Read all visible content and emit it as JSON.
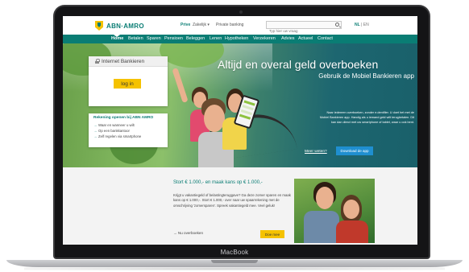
{
  "device": {
    "label": "MacBook"
  },
  "topbar": {
    "logo_text": "ABN·AMRO",
    "segments": [
      "Prive",
      "Zakelijk ▾",
      "Private banking"
    ],
    "search": {
      "placeholder": "Typ hier uw vraag"
    },
    "lang": {
      "nl": "NL",
      "separator": " | ",
      "en": "EN"
    }
  },
  "nav": {
    "items": [
      "Home",
      "Betalen",
      "Sparen",
      "Pensioen",
      "Beleggen",
      "Lenen",
      "Hypotheken",
      "Verzekeren",
      "Advies",
      "Actueel",
      "Contact"
    ]
  },
  "hero": {
    "title": "Altijd en overal geld overboeken",
    "subtitle": "Gebruik de Mobiel Bankieren app",
    "body": "Naar iedereen overboeken, zonder e.dentifier. U doet het met de Mobiel Bankieren app. Handig als u iemand geld wilt terugbetalen. Dit kan dan direct met uw smartphone of tablet, waar u ook bent.",
    "link": "Meer weten?",
    "button": "Download de app"
  },
  "login_card": {
    "title": "Internet Bankieren",
    "button": "log in"
  },
  "account_card": {
    "title": "Rekening openen bij ABN AMRO",
    "items": [
      "Waar en wanneer u wilt",
      "Op een bankkantoor",
      "Zelf regelen via smartphone"
    ]
  },
  "promo": {
    "title": "Stort € 1.000,- en maak kans op € 1.000,-",
    "body": "Krijgt u vakantiegeld of belastingteruggave? Ga deze zomer sparen en maak kans op € 1.000,-. Stort € 1.000,- over naar uw spaarrekening met de omschrijving 'zomersparen'. Spreek vakantiegeld mee. Veel geluk!",
    "link": "Nu overboeken",
    "button": "Doe mee"
  },
  "colors": {
    "brand_green": "#0a7d74",
    "brand_yellow": "#f5c200",
    "hero_button_blue": "#1f8fd0"
  }
}
